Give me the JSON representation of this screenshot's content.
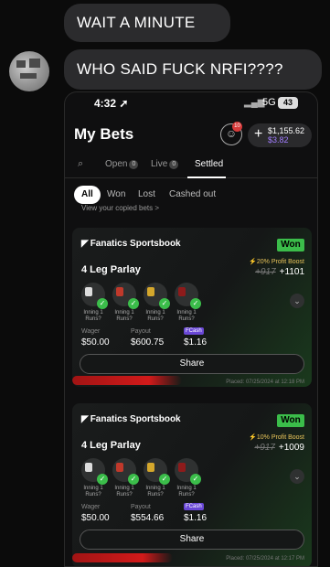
{
  "messages": [
    {
      "text": "WAIT A MINUTE"
    },
    {
      "text": "WHO SAID FUCK NRFI????"
    }
  ],
  "status_bar": {
    "time": "4:32",
    "network": "5G",
    "battery": "43"
  },
  "header": {
    "title": "My Bets",
    "notification_count": "10",
    "balance": "$1,155.62",
    "bonus": "$3.82"
  },
  "tabs": [
    {
      "label": "Open",
      "count": "0"
    },
    {
      "label": "Live",
      "count": "0"
    },
    {
      "label": "Settled",
      "count": ""
    }
  ],
  "filters": [
    "All",
    "Won",
    "Lost",
    "Cashed out"
  ],
  "copied_link": "View your copied bets >",
  "bets": [
    {
      "brand": "Fanatics Sportsbook",
      "status": "Won",
      "type": "4 Leg Parlay",
      "boost": "20% Profit Boost",
      "old_odds": "+917",
      "odds": "+1101",
      "legs": [
        "Inning 1 Runs?",
        "Inning 1 Runs?",
        "Inning 1 Runs?",
        "Inning 1 Runs?"
      ],
      "wager_label": "Wager",
      "wager": "$50.00",
      "payout_label": "Payout",
      "payout": "$600.75",
      "cash_label": "FCash",
      "cash": "$1.16",
      "share_label": "Share",
      "placed": "Placed: 07/25/2024 at 12:18 PM"
    },
    {
      "brand": "Fanatics Sportsbook",
      "status": "Won",
      "type": "4 Leg Parlay",
      "boost": "10% Profit Boost",
      "old_odds": "+917",
      "odds": "+1009",
      "legs": [
        "Inning 1 Runs?",
        "Inning 1 Runs?",
        "Inning 1 Runs?",
        "Inning 1 Runs?"
      ],
      "wager_label": "Wager",
      "wager": "$50.00",
      "payout_label": "Payout",
      "payout": "$554.66",
      "cash_label": "FCash",
      "cash": "$1.16",
      "share_label": "Share",
      "placed": "Placed: 07/25/2024 at 12:17 PM"
    }
  ],
  "colors": {
    "accent_green": "#3bbd4a",
    "boost_gold": "#e8c45a",
    "fcash_purple": "#6a48d6",
    "redaction_red": "#d21a1a"
  }
}
